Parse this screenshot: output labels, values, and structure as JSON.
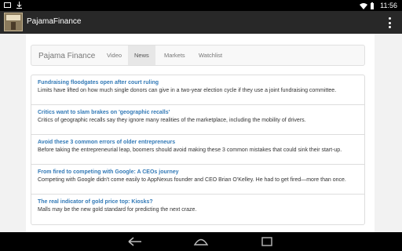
{
  "status_bar": {
    "time": "11:56",
    "icons": [
      "screenshot-icon",
      "download-icon",
      "wifi-icon",
      "battery-icon"
    ]
  },
  "app_bar": {
    "title": "PajamaFinance"
  },
  "nav": {
    "brand": "Pajama Finance",
    "links": [
      {
        "label": "Video",
        "active": false
      },
      {
        "label": "News",
        "active": true
      },
      {
        "label": "Markets",
        "active": false
      },
      {
        "label": "Watchlist",
        "active": false
      }
    ]
  },
  "news": [
    {
      "title": "Fundraising floodgates open after court ruling",
      "desc": "Limits have lifted on how much single donors can give in a two-year election cycle if they use a joint fundraising committee."
    },
    {
      "title": "Critics want to slam brakes on 'geographic recalls'",
      "desc": "Critics of geographic recalls say they ignore many realities of the marketplace, including the mobility of drivers."
    },
    {
      "title": "Avoid these 3 common errors of older entrepreneurs",
      "desc": "Before taking the entrepreneurial leap, boomers should avoid making these 3 common mistakes that could sink their start-up."
    },
    {
      "title": "From fired to competing with Google: A CEOs journey",
      "desc": "Competing with Google didn't come easily to AppNexus founder and CEO Brian O'Kelley. He had to get fired—more than once."
    },
    {
      "title": "The real indicator of gold price top: Kiosks?",
      "desc": "Malls may be the new gold standard for predicting the next craze."
    }
  ],
  "colors": {
    "link": "#337ab7",
    "appbar": "#282828",
    "status": "#000000"
  },
  "system_nav": [
    "back-icon",
    "home-icon",
    "recents-icon"
  ]
}
